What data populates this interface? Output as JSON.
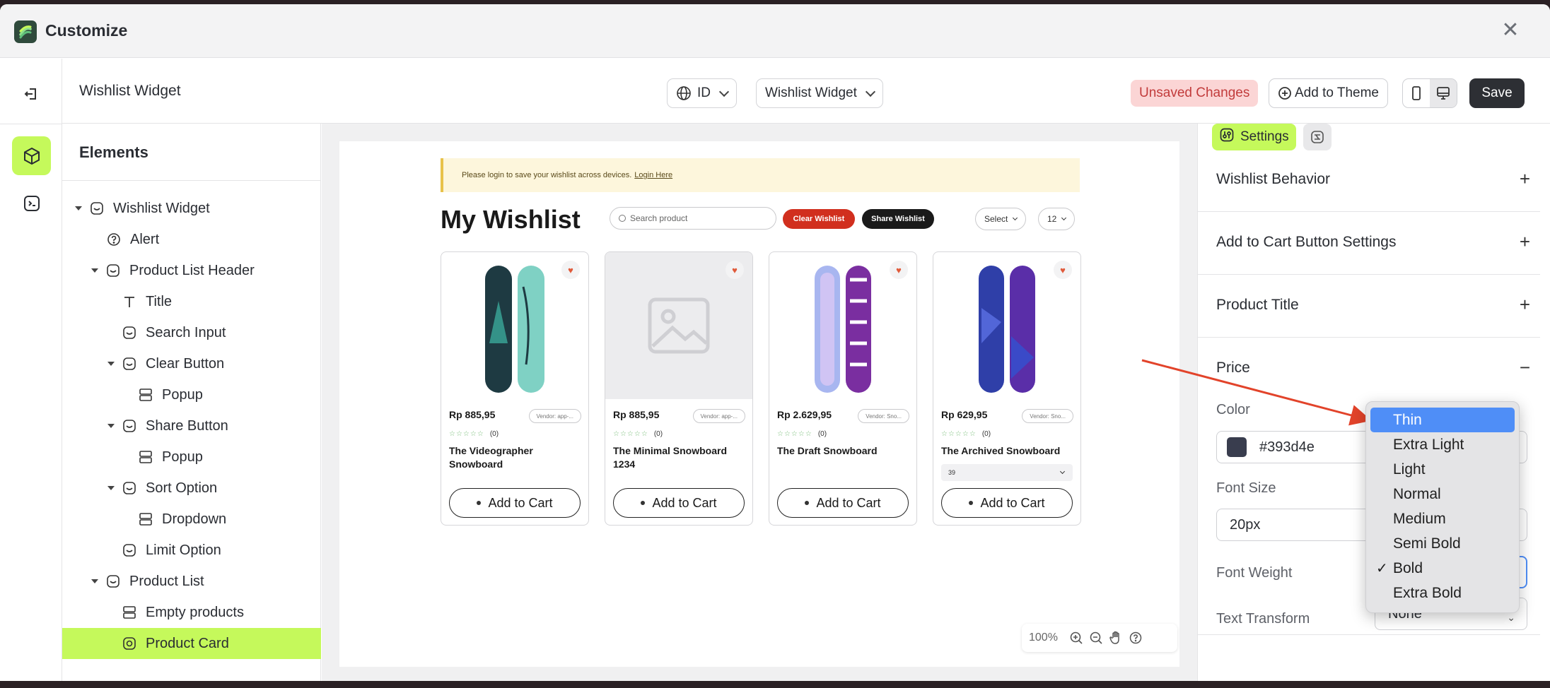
{
  "app": {
    "title": "Customize"
  },
  "topbar": {
    "page_name": "Wishlist Widget",
    "language": "ID",
    "template": "Wishlist Widget",
    "unsaved": "Unsaved Changes",
    "add_to_theme": "Add to Theme",
    "save": "Save"
  },
  "tree": {
    "title": "Elements",
    "nodes": [
      {
        "label": "Wishlist Widget"
      },
      {
        "label": "Alert"
      },
      {
        "label": "Product List Header"
      },
      {
        "label": "Title"
      },
      {
        "label": "Search Input"
      },
      {
        "label": "Clear Button"
      },
      {
        "label": "Popup"
      },
      {
        "label": "Share Button"
      },
      {
        "label": "Popup"
      },
      {
        "label": "Sort Option"
      },
      {
        "label": "Dropdown"
      },
      {
        "label": "Limit Option"
      },
      {
        "label": "Product List"
      },
      {
        "label": "Empty products"
      },
      {
        "label": "Product Card"
      }
    ]
  },
  "preview": {
    "alert_text": "Please login to save your wishlist across devices.",
    "alert_link": "Login Here",
    "heading": "My Wishlist",
    "search_placeholder": "Search product",
    "clear_label": "Clear Wishlist",
    "share_label": "Share Wishlist",
    "sort_label": "Select",
    "limit_label": "12",
    "products": [
      {
        "price": "Rp 885,95",
        "vendor": "Vendor: app-...",
        "reviews": "(0)",
        "name": "The Videographer Snowboard",
        "cta": "Add to Cart",
        "variant": ""
      },
      {
        "price": "Rp 885,95",
        "vendor": "Vendor: app-...",
        "reviews": "(0)",
        "name": "The Minimal Snowboard 1234",
        "cta": "Add to Cart",
        "variant": ""
      },
      {
        "price": "Rp 2.629,95",
        "vendor": "Vendor: Sno...",
        "reviews": "(0)",
        "name": "The Draft Snowboard",
        "cta": "Add to Cart",
        "variant": ""
      },
      {
        "price": "Rp 629,95",
        "vendor": "Vendor: Sno...",
        "reviews": "(0)",
        "name": "The Archived Snowboard",
        "cta": "Add to Cart",
        "variant": "39"
      }
    ],
    "zoom": "100%"
  },
  "settings": {
    "tab_label": "Settings",
    "sections": {
      "behavior": "Wishlist Behavior",
      "cart_button": "Add to Cart Button Settings",
      "product_title": "Product Title",
      "price": "Price"
    },
    "color_label": "Color",
    "color_value": "#393d4e",
    "font_size_label": "Font Size",
    "font_size_value": "20px",
    "font_weight_label": "Font Weight",
    "text_transform_label": "Text Transform",
    "text_transform_value": "None",
    "font_weight_options": [
      "Thin",
      "Extra Light",
      "Light",
      "Normal",
      "Medium",
      "Semi Bold",
      "Bold",
      "Extra Bold"
    ],
    "font_weight_selected": "Bold",
    "font_weight_highlighted": "Thin"
  },
  "colors": {
    "accent": "#c5f95b",
    "danger": "#d12f1e",
    "highlight": "#4f8ef7",
    "arrow": "#e2432a"
  }
}
